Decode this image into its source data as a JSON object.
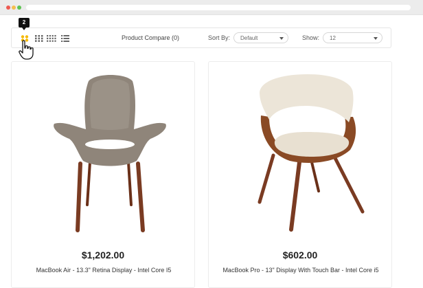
{
  "toolbar": {
    "view_options": [
      "2-column-grid",
      "3-column-grid",
      "4-column-grid",
      "list"
    ],
    "active_view_tooltip": "2",
    "compare_label": "Product Compare (0)",
    "sort_label": "Sort By:",
    "sort_value": "Default",
    "show_label": "Show:",
    "show_value": "12",
    "active_color": "#f5b800"
  },
  "products": [
    {
      "price": "$1,202.00",
      "title": "MacBook Air - 13.3\" Retina Display - Intel Core I5",
      "image": "upholstered-armchair-gray"
    },
    {
      "price": "$602.00",
      "title": "MacBook Pro - 13\" Display With Touch Bar - Intel Core i5",
      "image": "bentwood-chair-cream"
    }
  ]
}
